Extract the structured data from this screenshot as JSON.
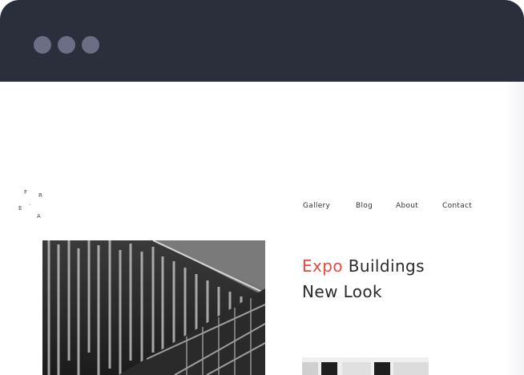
{
  "window": {
    "controls": [
      "close-dot",
      "minimize-dot",
      "maximize-dot"
    ]
  },
  "logo": {
    "letters": [
      "F",
      "R",
      "E",
      "A",
      "."
    ]
  },
  "nav": {
    "items": [
      {
        "label": "Gallery"
      },
      {
        "label": "Blog"
      },
      {
        "label": "About"
      },
      {
        "label": "Contact"
      }
    ]
  },
  "hero": {
    "headline_accent": "Expo",
    "headline_rest": "Buildings",
    "headline_line2": "New Look"
  },
  "colors": {
    "titlebar": "#2b2e3b",
    "dots": "#6b6f86",
    "accent": "#e8493e",
    "text": "#2a2a2a"
  }
}
